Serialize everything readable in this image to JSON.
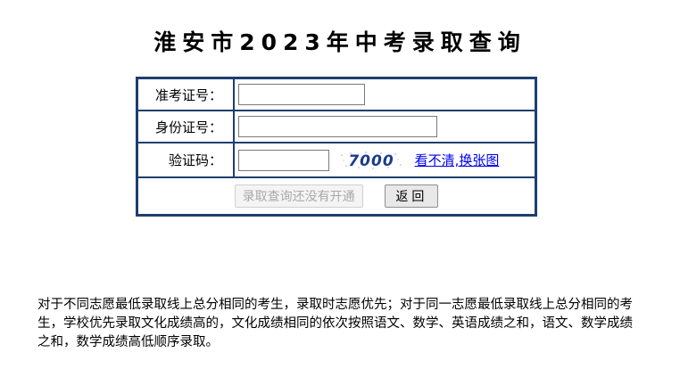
{
  "page": {
    "title": "淮安市2023年中考录取查询"
  },
  "form": {
    "exam_number_label": "准考证号：",
    "exam_number_value": "",
    "id_number_label": "身份证号：",
    "id_number_value": "",
    "captcha_label": "验证码：",
    "captcha_value": "",
    "captcha_text": "7000",
    "refresh_captcha_link": "看不清,换张图",
    "submit_button": "录取查询还没有开通",
    "back_button": "返回"
  },
  "note": {
    "text": "对于不同志愿最低录取线上总分相同的考生，录取时志愿优先；对于同一志愿最低录取线上总分相同的考生，学校优先录取文化成绩高的，文化成绩相同的依次按照语文、数学、英语成绩之和，语文、数学成绩之和，数学成绩高低顺序录取。"
  },
  "colors": {
    "table_border": "#1d3f6e",
    "captcha_text": "#1a3a8c",
    "link": "#0000ee"
  }
}
